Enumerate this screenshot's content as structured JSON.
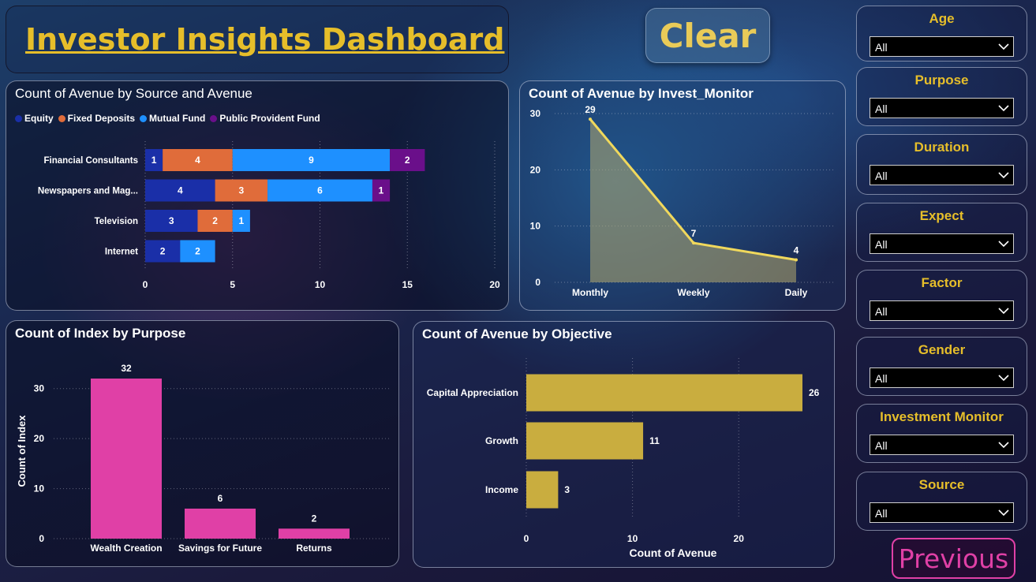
{
  "header": {
    "title": "Investor Insights Dashboard"
  },
  "buttons": {
    "clear": "Clear",
    "previous": "Previous"
  },
  "slicers": [
    {
      "label": "Age",
      "value": "All"
    },
    {
      "label": "Purpose",
      "value": "All"
    },
    {
      "label": "Duration",
      "value": "All"
    },
    {
      "label": "Expect",
      "value": "All"
    },
    {
      "label": "Factor",
      "value": "All"
    },
    {
      "label": "Gender",
      "value": "All"
    },
    {
      "label": "Investment Monitor",
      "value": "All"
    },
    {
      "label": "Source",
      "value": "All"
    }
  ],
  "colors": {
    "equity": "#1a2fa8",
    "fixed_deposits": "#e06c3a",
    "mutual_fund": "#1e90ff",
    "ppf": "#6a0f8a",
    "pink": "#e040a6",
    "gold": "#c9ad3f",
    "line": "#f0d85c"
  },
  "chart_data": [
    {
      "id": "source_avenue",
      "type": "bar",
      "orientation": "horizontal",
      "stacked": true,
      "title": "Count of Avenue by Source and Avenue",
      "categories": [
        "Financial Consultants",
        "Newspapers and Mag...",
        "Television",
        "Internet"
      ],
      "series": [
        {
          "name": "Equity",
          "values": [
            1,
            4,
            3,
            2
          ]
        },
        {
          "name": "Fixed Deposits",
          "values": [
            4,
            3,
            2,
            0
          ]
        },
        {
          "name": "Mutual Fund",
          "values": [
            9,
            6,
            1,
            2
          ]
        },
        {
          "name": "Public Provident Fund",
          "values": [
            2,
            1,
            0,
            0
          ]
        }
      ],
      "xlim": [
        0,
        20
      ],
      "xticks": [
        "0",
        "5",
        "10",
        "15",
        "20"
      ],
      "legend": "top-left",
      "grid": true
    },
    {
      "id": "invest_monitor",
      "type": "area",
      "title": "Count of Avenue by Invest_Monitor",
      "categories": [
        "Monthly",
        "Weekly",
        "Daily"
      ],
      "values": [
        29,
        7,
        4
      ],
      "ylim": [
        0,
        30
      ],
      "yticks": [
        "0",
        "10",
        "20",
        "30"
      ],
      "grid": true
    },
    {
      "id": "purpose",
      "type": "bar",
      "title": "Count of Index by Purpose",
      "categories": [
        "Wealth Creation",
        "Savings for Future",
        "Returns"
      ],
      "values": [
        32,
        6,
        2
      ],
      "ylabel": "Count of Index",
      "ylim": [
        0,
        35
      ],
      "yticks": [
        "0",
        "10",
        "20",
        "30"
      ],
      "grid": true
    },
    {
      "id": "objective",
      "type": "bar",
      "orientation": "horizontal",
      "title": "Count of Avenue by Objective",
      "categories": [
        "Capital Appreciation",
        "Growth",
        "Income"
      ],
      "values": [
        26,
        11,
        3
      ],
      "xlabel": "Count of Avenue",
      "xlim": [
        0,
        26
      ],
      "xticks": [
        "0",
        "10",
        "20"
      ],
      "grid": true
    }
  ]
}
